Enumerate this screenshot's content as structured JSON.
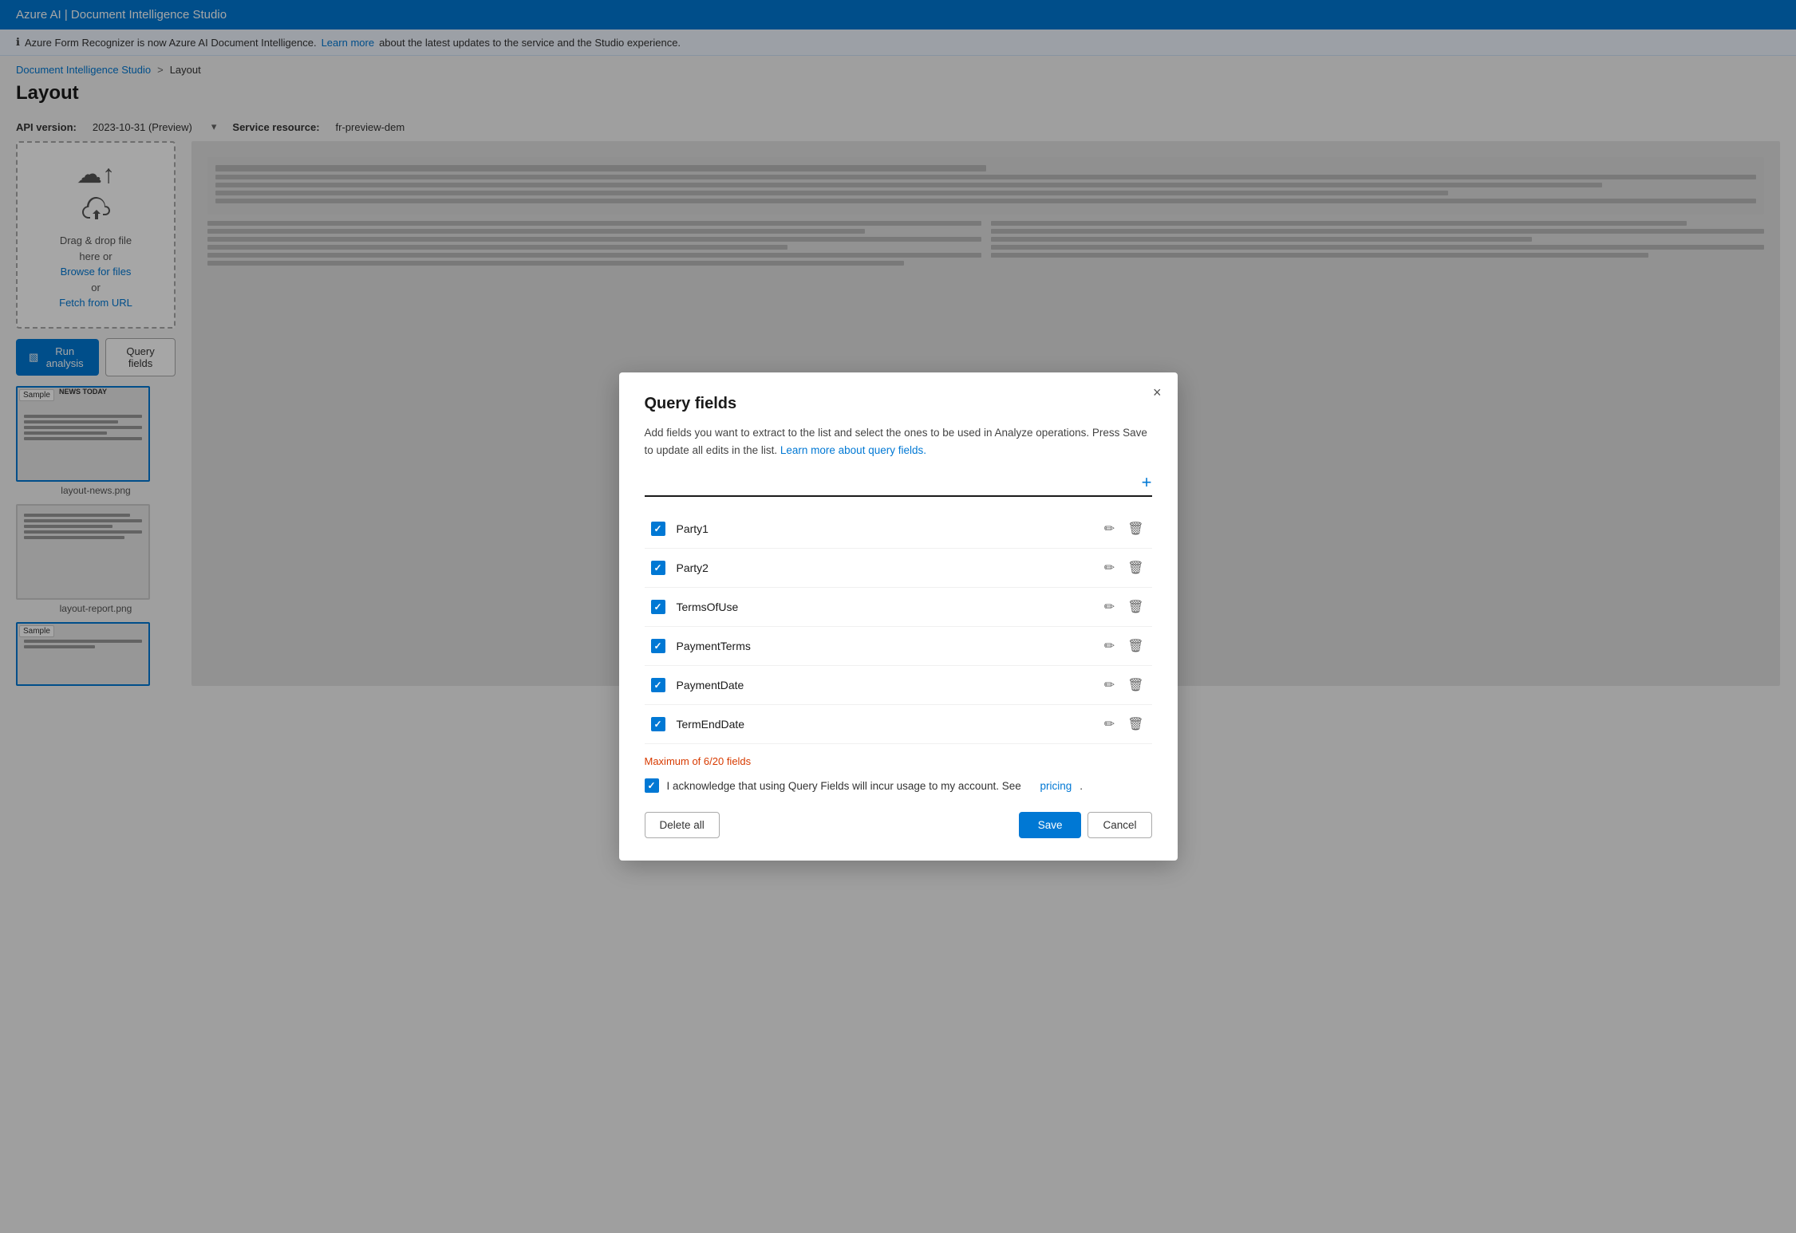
{
  "app": {
    "title": "Azure AI | Document Intelligence Studio"
  },
  "info_bar": {
    "icon": "ℹ",
    "text": "Azure Form Recognizer is now Azure AI Document Intelligence.",
    "link_text": "Learn more",
    "text2": "about the latest updates to the service and the Studio experience."
  },
  "breadcrumb": {
    "parent": "Document Intelligence Studio",
    "separator": ">",
    "current": "Layout"
  },
  "page_title": "Layout",
  "api_bar": {
    "api_label": "API version:",
    "api_value": "2023-10-31 (Preview)",
    "service_label": "Service resource:",
    "service_value": "fr-preview-dem"
  },
  "toolbar": {
    "run_analysis_label": "Run analysis",
    "query_fields_label": "Query fields"
  },
  "upload_box": {
    "text1": "Drag & drop file",
    "text2": "here or",
    "browse_label": "Browse for files",
    "text3": "or",
    "fetch_label": "Fetch from URL"
  },
  "thumbnails": [
    {
      "label": "layout-news.png",
      "has_sample": true,
      "title": "NEWS TODAY"
    },
    {
      "label": "layout-report.png",
      "has_sample": false,
      "title": ""
    },
    {
      "label": "",
      "has_sample": true,
      "title": ""
    }
  ],
  "modal": {
    "title": "Query fields",
    "close_label": "×",
    "description": "Add fields you want to extract to the list and select the ones to be used in Analyze operations. Press Save to update all edits in the list.",
    "learn_more_text": "Learn more about query fields.",
    "add_field_placeholder": "",
    "add_btn_label": "+",
    "fields": [
      {
        "id": "party1",
        "name": "Party1",
        "checked": true
      },
      {
        "id": "party2",
        "name": "Party2",
        "checked": true
      },
      {
        "id": "termsofuse",
        "name": "TermsOfUse",
        "checked": true
      },
      {
        "id": "paymentterms",
        "name": "PaymentTerms",
        "checked": true
      },
      {
        "id": "paymentdate",
        "name": "PaymentDate",
        "checked": true
      },
      {
        "id": "termenddate",
        "name": "TermEndDate",
        "checked": true
      }
    ],
    "max_notice": "Maximum of 6/20 fields",
    "ack_text": "I acknowledge that using Query Fields will incur usage to my account. See",
    "ack_link": "pricing",
    "ack_text2": ".",
    "delete_all_label": "Delete all",
    "save_label": "Save",
    "cancel_label": "Cancel"
  }
}
